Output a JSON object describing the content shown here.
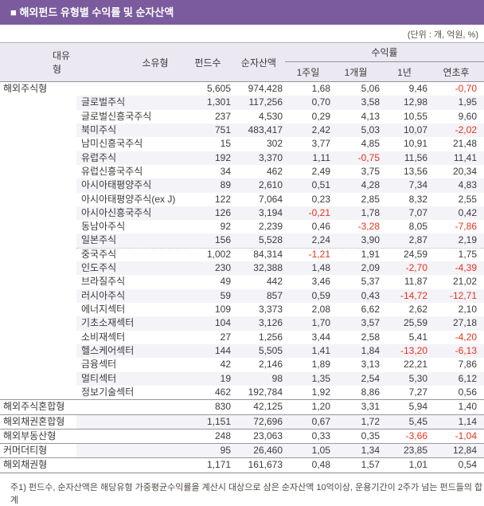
{
  "title": "■ 해외펀드 유형별 수익률 및 순자산액",
  "unit_label": "(단위 : 개, 억원, %)",
  "colors": {
    "accent_purple": "#7b5b9e",
    "header_bg": "#ebe8f1",
    "row_stripe": "#f4f3f8",
    "negative_red": "#e8321b"
  },
  "table": {
    "headers": {
      "major_type": "대유형",
      "minor_type": "소유형",
      "fund_count": "펀드수",
      "net_assets": "순자산액",
      "returns_group": "수익률",
      "sub": [
        "1주일",
        "1개월",
        "1년",
        "연초후"
      ]
    },
    "rows": [
      {
        "major": "해외주식형",
        "minor": "",
        "funds": "5,605",
        "nav": "974,428",
        "w1": "1,68",
        "m1": "5,06",
        "y1": "9,46",
        "ytd": "-0,70",
        "stripe": false,
        "dotted_after": true,
        "solid_after": false
      },
      {
        "major": "",
        "minor": "글로벌주식",
        "funds": "1,301",
        "nav": "117,256",
        "w1": "0,70",
        "m1": "3,58",
        "y1": "12,98",
        "ytd": "1,95",
        "stripe": true,
        "dotted_after": false,
        "solid_after": false
      },
      {
        "major": "",
        "minor": "글로벌신흥국주식",
        "funds": "237",
        "nav": "4,530",
        "w1": "0,29",
        "m1": "4,13",
        "y1": "10,55",
        "ytd": "9,60",
        "stripe": false,
        "dotted_after": false,
        "solid_after": false
      },
      {
        "major": "",
        "minor": "북미주식",
        "funds": "751",
        "nav": "483,417",
        "w1": "2,42",
        "m1": "5,03",
        "y1": "10,07",
        "ytd": "-2,02",
        "stripe": true,
        "dotted_after": false,
        "solid_after": false
      },
      {
        "major": "",
        "minor": "남미신흥국주식",
        "funds": "15",
        "nav": "302",
        "w1": "3,77",
        "m1": "4,85",
        "y1": "10,91",
        "ytd": "21,48",
        "stripe": false,
        "dotted_after": false,
        "solid_after": false
      },
      {
        "major": "",
        "minor": "유럽주식",
        "funds": "192",
        "nav": "3,370",
        "w1": "1,11",
        "m1": "-0,75",
        "y1": "11,56",
        "ytd": "11,41",
        "stripe": true,
        "dotted_after": false,
        "solid_after": false
      },
      {
        "major": "",
        "minor": "유럽신흥국주식",
        "funds": "34",
        "nav": "462",
        "w1": "2,49",
        "m1": "3,75",
        "y1": "13,56",
        "ytd": "20,34",
        "stripe": false,
        "dotted_after": false,
        "solid_after": false
      },
      {
        "major": "",
        "minor": "아시아태평양주식",
        "funds": "89",
        "nav": "2,610",
        "w1": "0,51",
        "m1": "4,28",
        "y1": "7,34",
        "ytd": "4,83",
        "stripe": true,
        "dotted_after": false,
        "solid_after": false
      },
      {
        "major": "",
        "minor": "아시아태평양주식(ex J)",
        "funds": "122",
        "nav": "7,064",
        "w1": "0,23",
        "m1": "2,85",
        "y1": "8,32",
        "ytd": "2,55",
        "stripe": false,
        "dotted_after": false,
        "solid_after": false
      },
      {
        "major": "",
        "minor": "아시아신흥국주식",
        "funds": "126",
        "nav": "3,194",
        "w1": "-0,21",
        "m1": "1,78",
        "y1": "7,07",
        "ytd": "0,42",
        "stripe": true,
        "dotted_after": false,
        "solid_after": false
      },
      {
        "major": "",
        "minor": "동남아주식",
        "funds": "92",
        "nav": "2,239",
        "w1": "0,46",
        "m1": "-3,28",
        "y1": "8,05",
        "ytd": "-7,86",
        "stripe": false,
        "dotted_after": false,
        "solid_after": false
      },
      {
        "major": "",
        "minor": "일본주식",
        "funds": "156",
        "nav": "5,528",
        "w1": "2,24",
        "m1": "3,90",
        "y1": "2,87",
        "ytd": "2,19",
        "stripe": true,
        "dotted_after": true,
        "solid_after": false
      },
      {
        "major": "",
        "minor": "중국주식",
        "funds": "1,002",
        "nav": "84,314",
        "w1": "-1,21",
        "m1": "1,91",
        "y1": "24,59",
        "ytd": "1,75",
        "stripe": false,
        "dotted_after": false,
        "solid_after": false
      },
      {
        "major": "",
        "minor": "인도주식",
        "funds": "230",
        "nav": "32,388",
        "w1": "1,48",
        "m1": "2,09",
        "y1": "-2,70",
        "ytd": "-4,39",
        "stripe": true,
        "dotted_after": false,
        "solid_after": false
      },
      {
        "major": "",
        "minor": "브라질주식",
        "funds": "49",
        "nav": "442",
        "w1": "3,46",
        "m1": "5,37",
        "y1": "11,87",
        "ytd": "21,02",
        "stripe": false,
        "dotted_after": false,
        "solid_after": false
      },
      {
        "major": "",
        "minor": "러시아주식",
        "funds": "59",
        "nav": "857",
        "w1": "0,59",
        "m1": "0,43",
        "y1": "-14,72",
        "ytd": "-12,71",
        "stripe": true,
        "dotted_after": false,
        "solid_after": false
      },
      {
        "major": "",
        "minor": "에너지섹터",
        "funds": "109",
        "nav": "3,373",
        "w1": "2,08",
        "m1": "6,62",
        "y1": "2,62",
        "ytd": "2,10",
        "stripe": false,
        "dotted_after": true,
        "solid_after": false
      },
      {
        "major": "",
        "minor": "기초소재섹터",
        "funds": "104",
        "nav": "3,126",
        "w1": "1,70",
        "m1": "3,57",
        "y1": "25,59",
        "ytd": "27,18",
        "stripe": true,
        "dotted_after": false,
        "solid_after": false
      },
      {
        "major": "",
        "minor": "소비재섹터",
        "funds": "27",
        "nav": "1,256",
        "w1": "3,44",
        "m1": "2,58",
        "y1": "5,41",
        "ytd": "-4,20",
        "stripe": false,
        "dotted_after": false,
        "solid_after": false
      },
      {
        "major": "",
        "minor": "헬스케어섹터",
        "funds": "144",
        "nav": "5,505",
        "w1": "1,41",
        "m1": "1,84",
        "y1": "-13,20",
        "ytd": "-6,13",
        "stripe": true,
        "dotted_after": false,
        "solid_after": false
      },
      {
        "major": "",
        "minor": "금융섹터",
        "funds": "42",
        "nav": "2,146",
        "w1": "1,89",
        "m1": "3,13",
        "y1": "22,21",
        "ytd": "7,86",
        "stripe": false,
        "dotted_after": false,
        "solid_after": false
      },
      {
        "major": "",
        "minor": "멀티섹터",
        "funds": "19",
        "nav": "98",
        "w1": "1,35",
        "m1": "2,54",
        "y1": "5,30",
        "ytd": "6,12",
        "stripe": true,
        "dotted_after": false,
        "solid_after": false
      },
      {
        "major": "",
        "minor": "정보기술섹터",
        "funds": "462",
        "nav": "192,784",
        "w1": "1,92",
        "m1": "8,86",
        "y1": "7,27",
        "ytd": "0,56",
        "stripe": false,
        "dotted_after": false,
        "solid_after": true
      },
      {
        "major": "해외주식혼합형",
        "minor": "",
        "funds": "830",
        "nav": "42,125",
        "w1": "1,20",
        "m1": "3,31",
        "y1": "5,94",
        "ytd": "1,40",
        "stripe": false,
        "dotted_after": false,
        "solid_after": true
      },
      {
        "major": "해외채권혼합형",
        "minor": "",
        "funds": "1,151",
        "nav": "72,696",
        "w1": "0,67",
        "m1": "1,72",
        "y1": "5,45",
        "ytd": "1,14",
        "stripe": true,
        "dotted_after": false,
        "solid_after": true
      },
      {
        "major": "해외부동산형",
        "minor": "",
        "funds": "248",
        "nav": "23,063",
        "w1": "0,33",
        "m1": "0,35",
        "y1": "-3,66",
        "ytd": "-1,04",
        "stripe": false,
        "dotted_after": false,
        "solid_after": true
      },
      {
        "major": "커머더티형",
        "minor": "",
        "funds": "95",
        "nav": "26,460",
        "w1": "1,05",
        "m1": "1,34",
        "y1": "23,85",
        "ytd": "12,84",
        "stripe": true,
        "dotted_after": false,
        "solid_after": true
      },
      {
        "major": "해외채권형",
        "minor": "",
        "funds": "1,171",
        "nav": "161,673",
        "w1": "0,48",
        "m1": "1,57",
        "y1": "1,01",
        "ytd": "0,54",
        "stripe": false,
        "dotted_after": false,
        "solid_after": false
      }
    ]
  },
  "footnote": "주1) 펀드수, 순자산액은 해당유형 가중평균수익률을 계산시 대상으로 삼은 순자산액 10억이상, 운용기간이 2주가 넘는 펀드들의 합계"
}
